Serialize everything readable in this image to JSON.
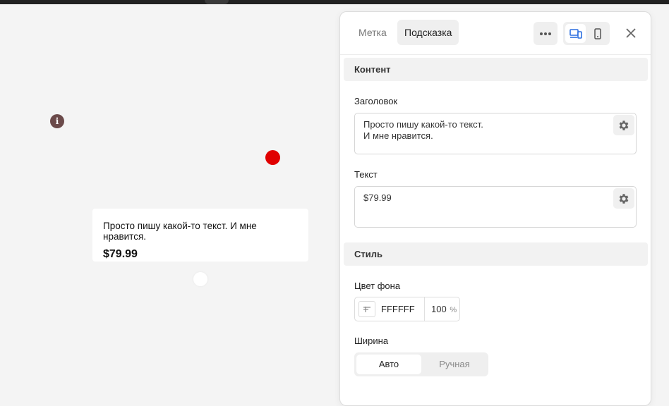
{
  "canvas": {
    "info_icon_glyph": "i",
    "tooltip_card": {
      "title": "Просто пишу какой-то текст. И мне нравится.",
      "price": "$79.99"
    },
    "marker_color": "#e00000"
  },
  "panel": {
    "tabs": [
      {
        "label": "Метка",
        "active": false
      },
      {
        "label": "Подсказка",
        "active": true
      }
    ],
    "toolbar": {
      "more_icon": "more-horizontal-icon",
      "desktop_icon": "desktop-mobile-icon",
      "mobile_icon": "mobile-icon",
      "close_icon": "close-icon"
    },
    "content_section": {
      "title": "Контент",
      "heading_label": "Заголовок",
      "heading_lines": [
        "Просто пишу какой-то текст.",
        "И мне нравится."
      ],
      "text_label": "Текст",
      "text_value": "$79.99"
    },
    "style_section": {
      "title": "Стиль",
      "bg_color_label": "Цвет фона",
      "bg_color_hex": "FFFFFF",
      "bg_opacity": "100",
      "bg_opacity_unit": "%",
      "width_label": "Ширина",
      "width_options": [
        {
          "label": "Авто",
          "selected": true
        },
        {
          "label": "Ручная",
          "selected": false
        }
      ]
    }
  },
  "colors": {
    "accent": "#2d6fe0",
    "marker_red": "#e00000",
    "info_marker": "#6b4a4a"
  }
}
